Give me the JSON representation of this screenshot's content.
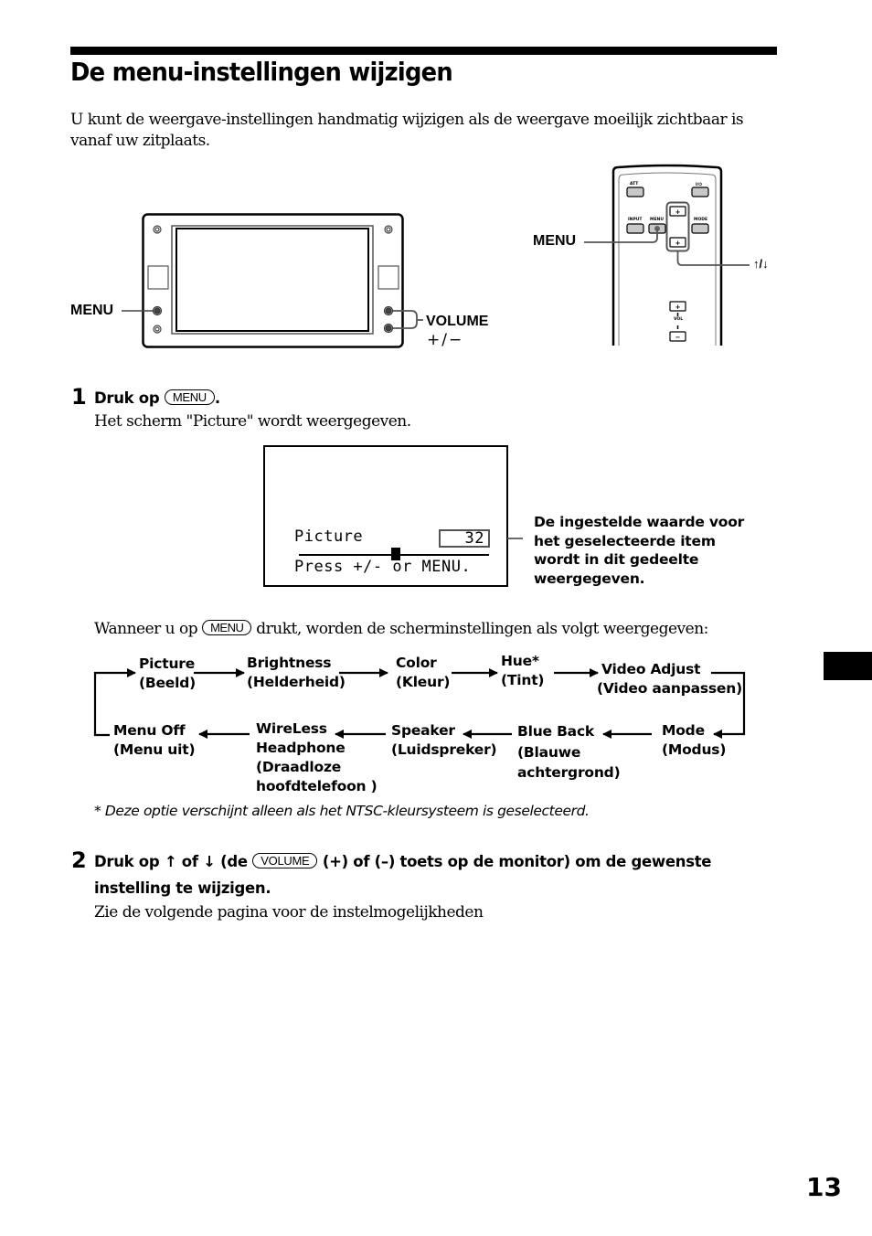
{
  "page": {
    "title": "De menu-instellingen wijzigen",
    "intro": "U kunt de weergave-instellingen handmatig wijzigen als de weergave moeilijk zichtbaar is vanaf uw zitplaats.",
    "page_number": "13"
  },
  "monitor_figure": {
    "menu_label": "MENU",
    "volume_label": "VOLUME",
    "volume_sub": "+/−"
  },
  "remote_figure": {
    "menu_label": "MENU",
    "updown_label": "↑/↓",
    "buttons": {
      "att": "ATT",
      "power": "I/⏻",
      "input": "INPUT",
      "menu": "MENU",
      "mode": "MODE",
      "vol": "VOL",
      "plus": "+",
      "minus": "−"
    }
  },
  "step1": {
    "number": "1",
    "heading_prefix": "Druk op",
    "key": "MENU",
    "heading_suffix": ".",
    "body": "Het scherm \"Picture\" wordt weergegeven."
  },
  "osd": {
    "item": "Picture",
    "value": "32",
    "hint": "Press +/- or MENU.",
    "slider_level_percent": 51,
    "callout": [
      "De ingestelde waarde voor",
      "het geselecteerde item",
      "wordt in dit gedeelte",
      "weergegeven."
    ]
  },
  "sequence_intro": {
    "prefix": "Wanneer u op",
    "key": "MENU",
    "suffix": "drukt, worden de scherminstellingen als volgt weergegeven:"
  },
  "menu_flow": [
    {
      "lines": [
        "Picture",
        "(Beeld)"
      ]
    },
    {
      "lines": [
        "Brightness",
        "(Helderheid)"
      ]
    },
    {
      "lines": [
        "Color",
        "(Kleur)"
      ]
    },
    {
      "lines": [
        "Hue*",
        "(Tint)"
      ]
    },
    {
      "lines": [
        "Video Adjust",
        "(Video aanpassen)"
      ]
    },
    {
      "lines": [
        "Mode",
        "(Modus)"
      ]
    },
    {
      "lines": [
        "Blue Back",
        "(Blauwe",
        "achtergrond)"
      ]
    },
    {
      "lines": [
        "Speaker",
        "(Luidspreker)"
      ]
    },
    {
      "lines": [
        "WireLess",
        "Headphone",
        "(Draadloze",
        "hoofdtelefoon )"
      ]
    },
    {
      "lines": [
        "Menu Off",
        "(Menu uit)"
      ]
    }
  ],
  "footnote": "* Deze optie verschijnt alleen als het NTSC-kleursysteem is geselecteerd.",
  "step2": {
    "number": "2",
    "part1": "Druk op",
    "up_arrow": "↑",
    "of": "of",
    "down_arrow": "↓",
    "part2": "(de",
    "key": "VOLUME",
    "part3": "(+) of (–) toets op de monitor) om de gewenste",
    "line2": "instelling te wijzigen.",
    "body": "Zie de volgende pagina voor de instelmogelijkheden"
  }
}
